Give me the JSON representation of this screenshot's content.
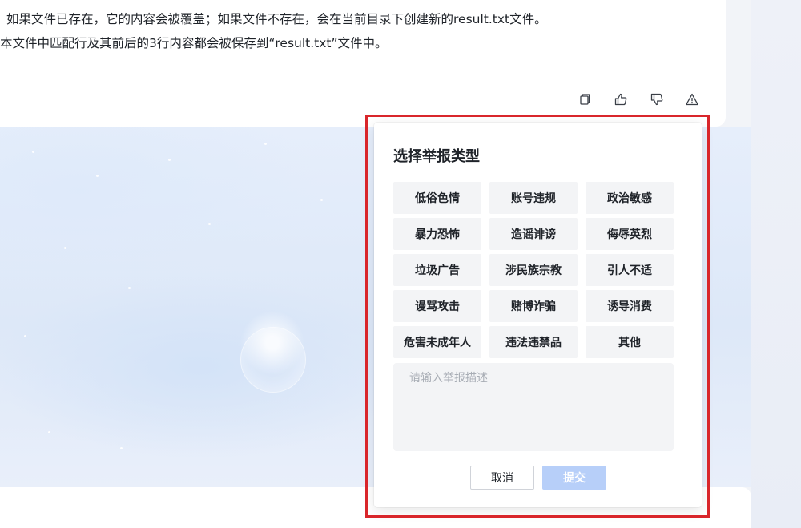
{
  "answer": {
    "line1": "如果文件已存在，它的内容会被覆盖；如果文件不存在，会在当前目录下创建新的result.txt文件。",
    "line2": "本文件中匹配行及其前后的3行内容都会被保存到“result.txt”文件中。"
  },
  "actions": [
    {
      "name": "copy",
      "icon": "copy-icon"
    },
    {
      "name": "like",
      "icon": "thumbs-up-icon"
    },
    {
      "name": "dislike",
      "icon": "thumbs-down-icon"
    },
    {
      "name": "report",
      "icon": "warning-icon"
    }
  ],
  "report_dialog": {
    "title": "选择举报类型",
    "types": [
      "低俗色情",
      "账号违规",
      "政治敏感",
      "暴力恐怖",
      "造谣诽谤",
      "侮辱英烈",
      "垃圾广告",
      "涉民族宗教",
      "引人不适",
      "谩骂攻击",
      "赌博诈骗",
      "诱导消费",
      "危害未成年人",
      "违法违禁品",
      "其他"
    ],
    "description_placeholder": "请输入举报描述",
    "description_value": "",
    "cancel_label": "取消",
    "submit_label": "提交"
  },
  "colors": {
    "highlight_border": "#d9262b",
    "submit_disabled_bg": "#b7cff9",
    "option_bg": "#f3f4f6"
  }
}
